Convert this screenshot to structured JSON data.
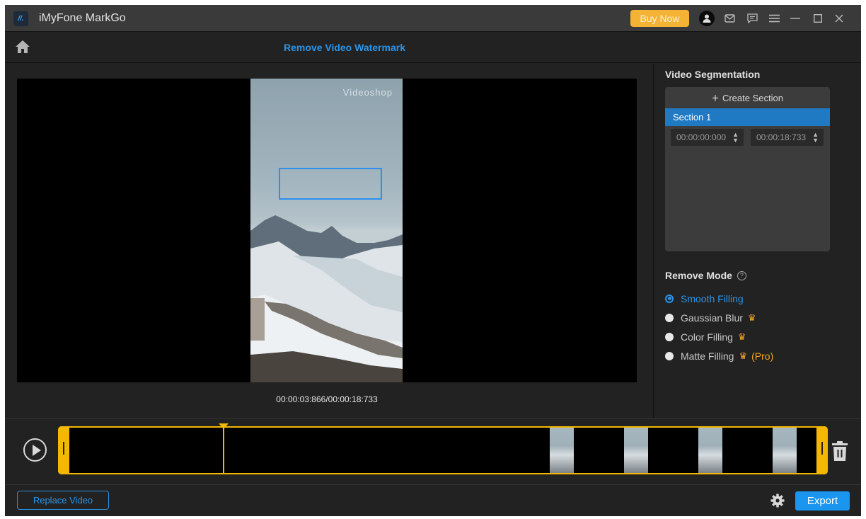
{
  "window": {
    "app_title": "iMyFone MarkGo",
    "logo_text": "//.",
    "buy_now_label": "Buy Now",
    "icons": [
      "user-icon",
      "mail-icon",
      "feedback-icon",
      "menu-icon",
      "minimize-icon",
      "maximize-icon",
      "close-icon"
    ]
  },
  "toolbar": {
    "page_title": "Remove Video Watermark"
  },
  "preview": {
    "watermark_text": "Videoshop",
    "timecode": "00:00:03:866/00:00:18:733"
  },
  "segmentation": {
    "title": "Video Segmentation",
    "create_label": "Create Section",
    "sections": [
      {
        "label": "Section 1",
        "start": "00:00:00:000",
        "end": "00:00:18:733",
        "selected": true
      }
    ]
  },
  "remove_mode": {
    "title": "Remove Mode",
    "options": [
      {
        "label": "Smooth Filling",
        "selected": true,
        "premium": false,
        "pro": ""
      },
      {
        "label": "Gaussian Blur",
        "selected": false,
        "premium": true,
        "pro": ""
      },
      {
        "label": "Color Filling",
        "selected": false,
        "premium": true,
        "pro": ""
      },
      {
        "label": "Matte Filling",
        "selected": false,
        "premium": true,
        "pro": "(Pro)"
      }
    ]
  },
  "timeline": {
    "playhead_fraction": 0.206,
    "thumbnails_at_fractions": [
      0.645,
      0.745,
      0.845,
      0.945
    ]
  },
  "footer": {
    "replace_label": "Replace Video",
    "export_label": "Export"
  },
  "colors": {
    "accent": "#2b94e8",
    "buy_now": "#f5b335",
    "timeline": "#f5b800",
    "export": "#1a96f0"
  }
}
